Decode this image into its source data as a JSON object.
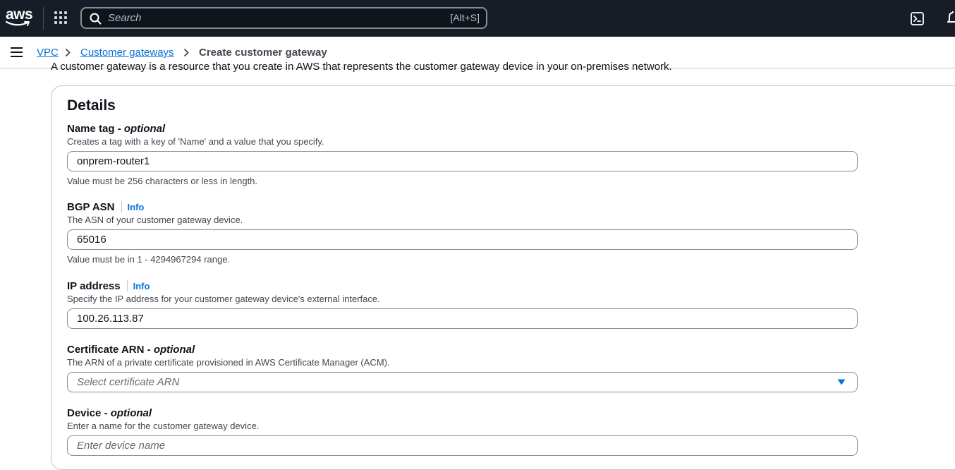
{
  "topnav": {
    "logo_text": "aws",
    "search_placeholder": "Search",
    "search_shortcut": "[Alt+S]"
  },
  "breadcrumb": {
    "items": [
      "VPC",
      "Customer gateways"
    ],
    "current": "Create customer gateway"
  },
  "intro_text": "A customer gateway is a resource that you create in AWS that represents the customer gateway device in your on-premises network.",
  "details": {
    "title": "Details",
    "name_tag": {
      "label": "Name tag - ",
      "label_suffix": "optional",
      "description": "Creates a tag with a key of 'Name' and a value that you specify.",
      "value": "onprem-router1",
      "constraint": "Value must be 256 characters or less in length."
    },
    "bgp_asn": {
      "label": "BGP ASN",
      "info": "Info",
      "description": "The ASN of your customer gateway device.",
      "value": "65016",
      "constraint": "Value must be in 1 - 4294967294 range."
    },
    "ip_address": {
      "label": "IP address",
      "info": "Info",
      "description": "Specify the IP address for your customer gateway device's external interface.",
      "value": "100.26.113.87"
    },
    "certificate_arn": {
      "label": "Certificate ARN - ",
      "label_suffix": "optional",
      "description": "The ARN of a private certificate provisioned in AWS Certificate Manager (ACM).",
      "placeholder": "Select certificate ARN"
    },
    "device": {
      "label": "Device - ",
      "label_suffix": "optional",
      "description": "Enter a name for the customer gateway device.",
      "placeholder": "Enter device name"
    }
  },
  "colors": {
    "topbar_bg": "#161d26",
    "link": "#0972d3",
    "border": "#8c8c94"
  }
}
